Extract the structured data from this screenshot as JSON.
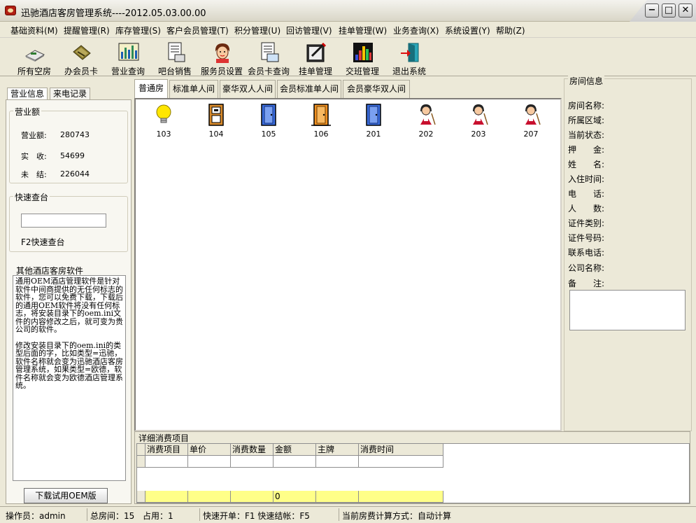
{
  "window": {
    "title": "迅驰酒店客房管理系统----2012.05.03.00.00",
    "minimize": "−",
    "maximize": "□",
    "close": "✕"
  },
  "menu": [
    "基础资料(M)",
    "提醒管理(R)",
    "库存管理(S)",
    "客户会员管理(T)",
    "积分管理(U)",
    "回访管理(V)",
    "挂单管理(W)",
    "业务查询(X)",
    "系统设置(Y)",
    "帮助(Z)"
  ],
  "toolbar": [
    {
      "label": "所有空房",
      "icon": "empty-rooms-icon"
    },
    {
      "label": "办会员卡",
      "icon": "member-card-icon"
    },
    {
      "label": "营业查询",
      "icon": "chart-icon"
    },
    {
      "label": "吧台销售",
      "icon": "document-icon"
    },
    {
      "label": "服务员设置",
      "icon": "waiter-icon"
    },
    {
      "label": "会员卡查询",
      "icon": "card-query-icon"
    },
    {
      "label": "挂单管理",
      "icon": "pending-order-icon"
    },
    {
      "label": "交班管理",
      "icon": "shift-icon"
    },
    {
      "label": "退出系统",
      "icon": "exit-icon"
    }
  ],
  "left_tabs": [
    "营业信息",
    "来电记录"
  ],
  "revenue": {
    "title": "营业额",
    "items": [
      {
        "label": "营业额:",
        "value": "280743"
      },
      {
        "label": "实　收:",
        "value": "54699"
      },
      {
        "label": "未　结:",
        "value": "226044"
      }
    ]
  },
  "quick_checkout": {
    "title": "快速查台",
    "value": "",
    "hint": "F2快速查台"
  },
  "other_software": {
    "title": "其他酒店客房软件",
    "paragraphs": [
      "通用OEM酒店管理软件是针对软件中间商提供的无任何标志的软件，您可以免费下载，下载后的通用OEM软件将没有任何标志，将安装目录下的oem.ini文件的内容修改之后，就可变为贵公司的软件。",
      "修改安装目录下的oem.ini的类型后面的字，比如类型=迅驰，软件名称就会变为迅驰酒店客房管理系统，如果类型=欧德，软件名称就会变为欧德酒店管理系统。"
    ],
    "button": "下载试用OEM版"
  },
  "room_tabs": [
    "普通房",
    "标准单人间",
    "豪华双人人间",
    "会员标准单人间",
    "会员豪华双人间"
  ],
  "rooms": [
    {
      "number": "103",
      "status": "lightbulb-icon"
    },
    {
      "number": "104",
      "status": "reserved-door-icon"
    },
    {
      "number": "105",
      "status": "vacant-door-icon"
    },
    {
      "number": "106",
      "status": "cleaning-door-icon"
    },
    {
      "number": "201",
      "status": "vacant-door-icon"
    },
    {
      "number": "202",
      "status": "housekeeping-maid-icon"
    },
    {
      "number": "203",
      "status": "housekeeping-maid-icon"
    },
    {
      "number": "207",
      "status": "housekeeping-maid-icon"
    }
  ],
  "detail": {
    "title": "详细消费项目",
    "columns": [
      "消费项目",
      "单价",
      "消费数量",
      "金额",
      "主牌",
      "消费时间"
    ],
    "totals": [
      "",
      "",
      "",
      "0",
      "",
      ""
    ]
  },
  "room_info": {
    "title": "房间信息",
    "labels": [
      "房间名称:",
      "所属区域:",
      "当前状态:",
      "押　　金:",
      "姓　　名:",
      "入住时间:",
      "电　　话:",
      "人　　数:",
      "证件类别:",
      "证件号码:",
      "联系电话:",
      "公司名称:",
      "备　　注:"
    ]
  },
  "status": {
    "operator": "操作员：admin",
    "total_rooms": "总房间：15",
    "occupied": "占用：1",
    "shortcuts": "快速开单：F1  快速结帐：F5",
    "billing_mode": "当前房费计算方式：自动计算"
  },
  "colors": {
    "window_bg": "#ece9d8",
    "footer_row": "#ffff88",
    "app_icon": "#b01e12"
  }
}
